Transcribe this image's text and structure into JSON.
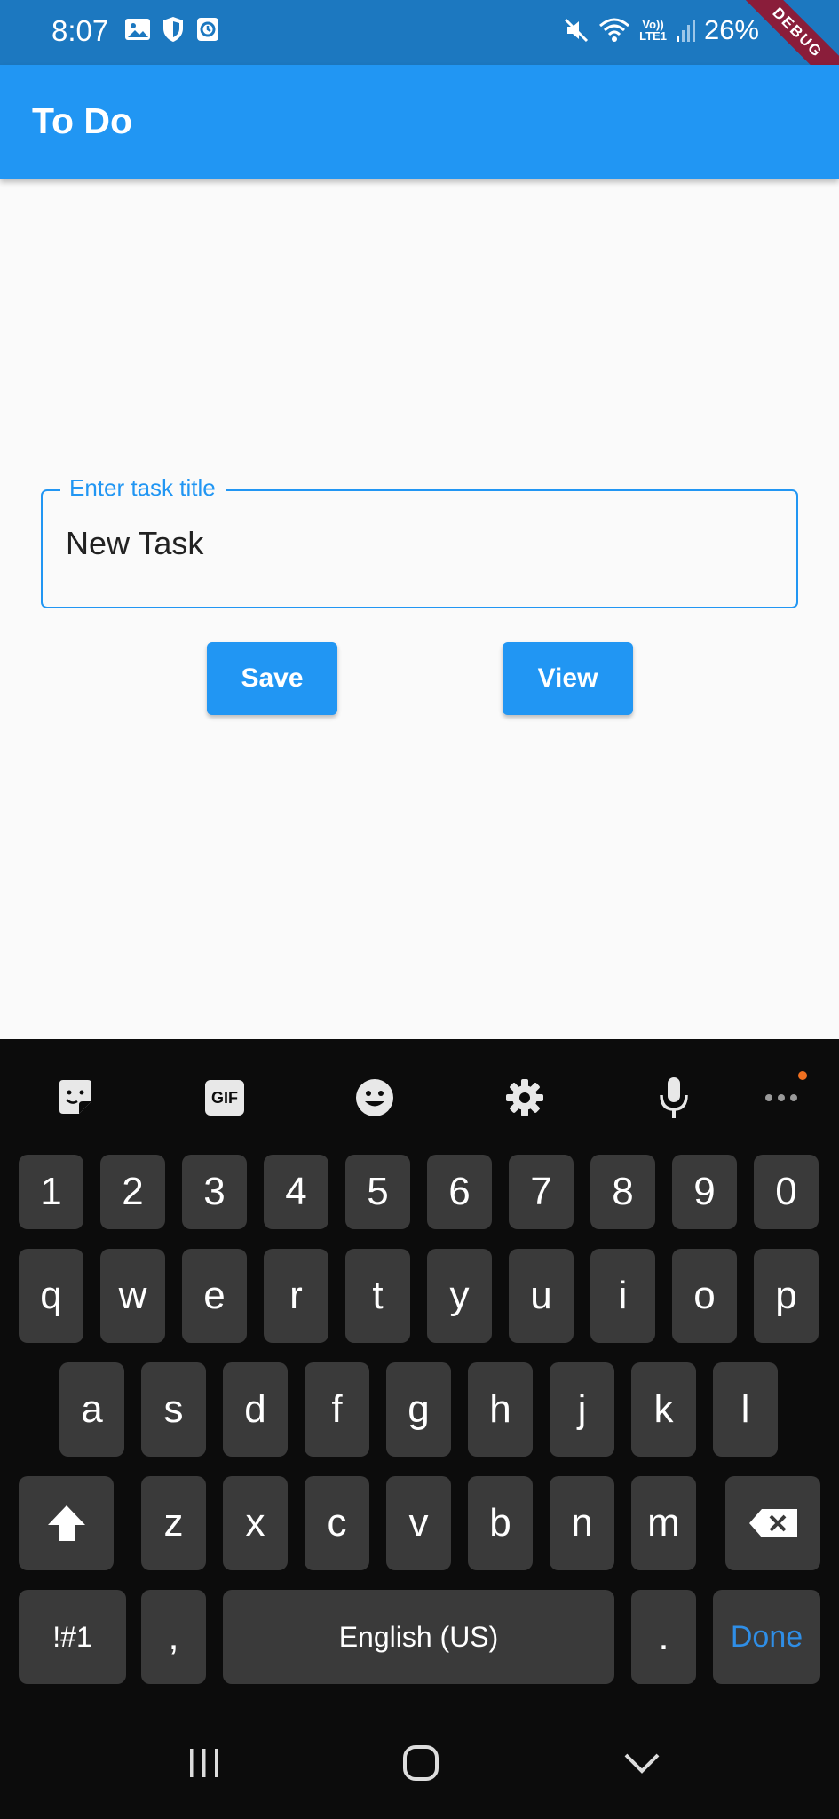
{
  "status_bar": {
    "time": "8:07",
    "battery": "26%",
    "network_top": "Vo))",
    "network_bottom": "LTE1"
  },
  "debug_banner": "DEBUG",
  "app_bar": {
    "title": "To Do"
  },
  "form": {
    "field_label": "Enter task title",
    "field_value": "New Task",
    "save_label": "Save",
    "view_label": "View"
  },
  "keyboard": {
    "toolbar": [
      "sticker-icon",
      "gif-icon",
      "emoji-icon",
      "settings-icon",
      "microphone-icon",
      "more-icon"
    ],
    "gif_label": "GIF",
    "row_numbers": [
      "1",
      "2",
      "3",
      "4",
      "5",
      "6",
      "7",
      "8",
      "9",
      "0"
    ],
    "row_top": [
      "q",
      "w",
      "e",
      "r",
      "t",
      "y",
      "u",
      "i",
      "o",
      "p"
    ],
    "row_middle": [
      "a",
      "s",
      "d",
      "f",
      "g",
      "h",
      "j",
      "k",
      "l"
    ],
    "row_bottom": [
      "z",
      "x",
      "c",
      "v",
      "b",
      "n",
      "m"
    ],
    "symbols_label": "!#1",
    "comma_label": ",",
    "space_label": "English (US)",
    "period_label": ".",
    "done_label": "Done"
  },
  "nav_bar": [
    "recents-icon",
    "home-icon",
    "back-icon"
  ],
  "colors": {
    "primary": "#2196f3",
    "status_bar": "#1c78c0",
    "keyboard_bg": "#0c0c0c",
    "key_bg": "#3a3a3a"
  }
}
